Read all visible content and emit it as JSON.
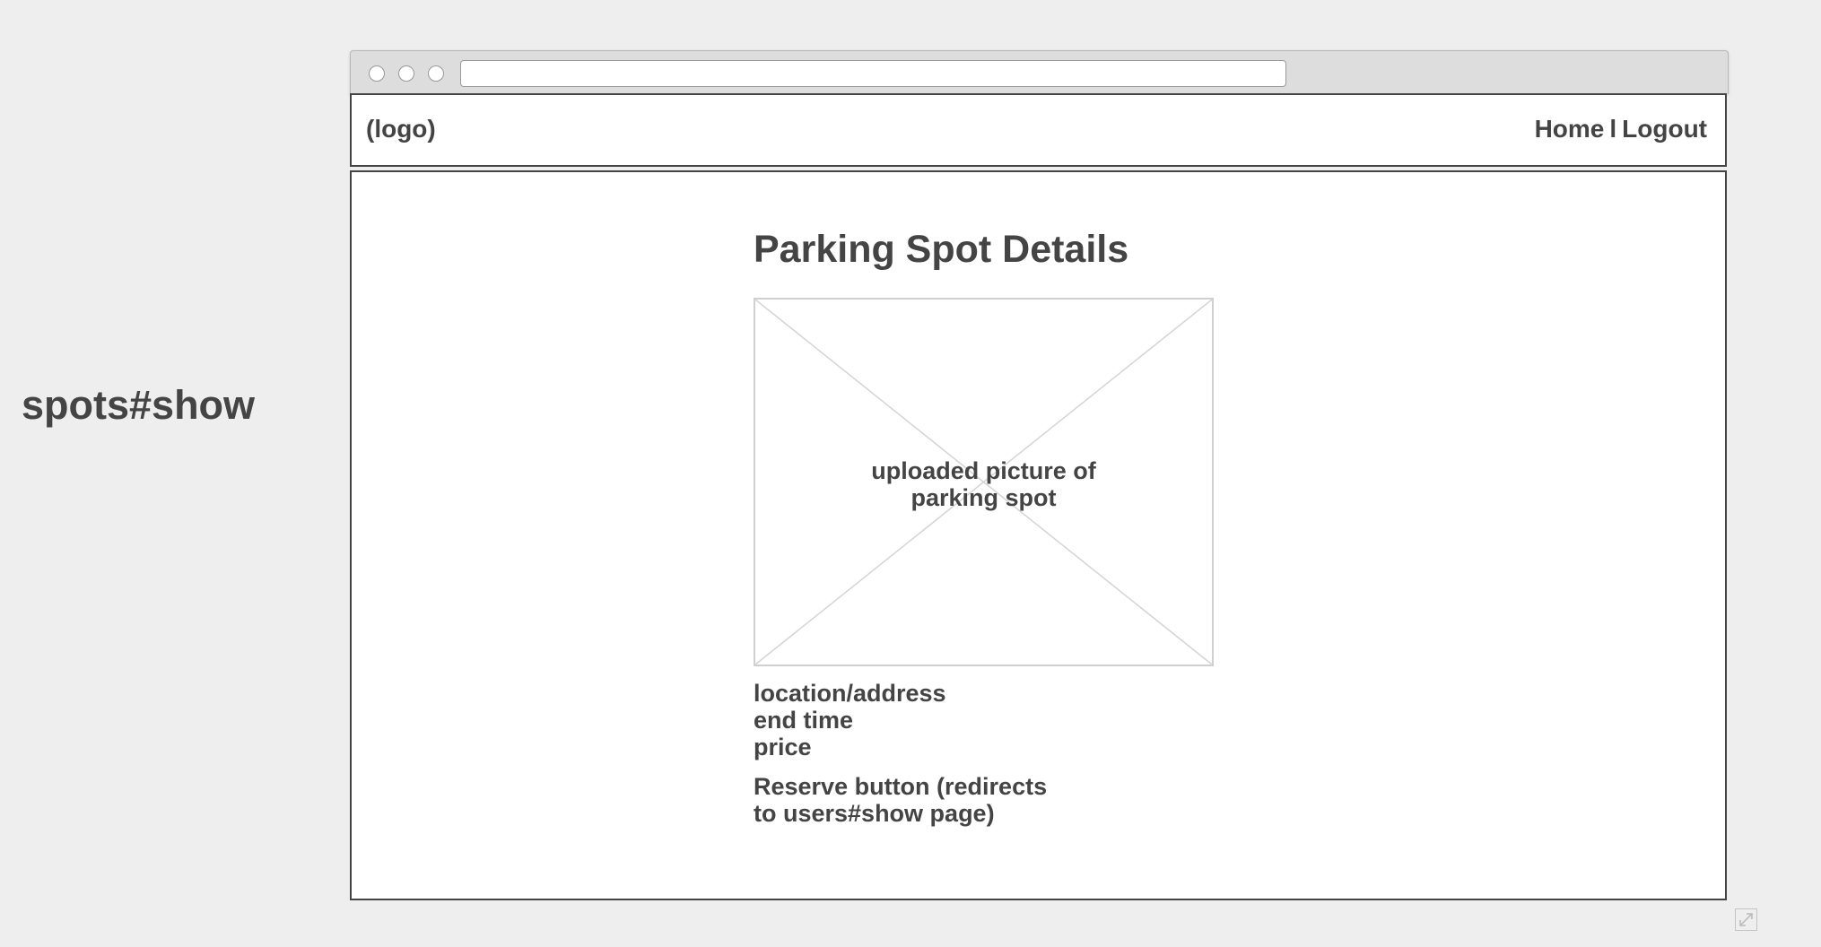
{
  "page_label": "spots#show",
  "browser": {
    "address": ""
  },
  "navbar": {
    "logo": "(logo)",
    "links": {
      "home": "Home",
      "separator": "l",
      "logout": "Logout"
    }
  },
  "content": {
    "title": "Parking Spot Details",
    "image_placeholder": {
      "caption_line1": "uploaded picture of",
      "caption_line2": "parking spot"
    },
    "details": [
      "location/address",
      "end time",
      "price"
    ],
    "reserve_note_line1": "Reserve button (redirects",
    "reserve_note_line2": "to users#show page)"
  },
  "icons": {
    "expand": "expand-icon"
  },
  "colors": {
    "background": "#eeeeee",
    "text": "#444444",
    "border": "#444444",
    "placeholder_border": "#d0d0d0"
  }
}
